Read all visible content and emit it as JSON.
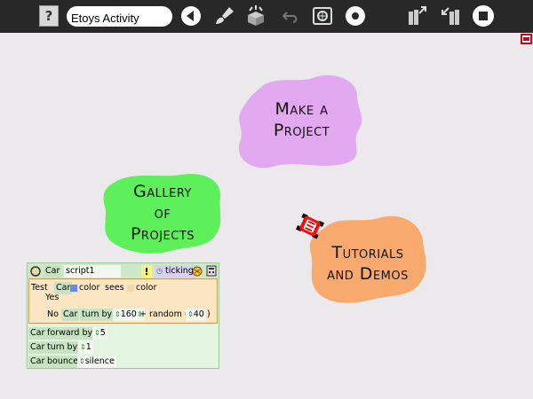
{
  "toolbar": {
    "project_title": "Etoys Activity",
    "help_label": "?",
    "icons": [
      "help-icon",
      "back-triangle-icon",
      "paint-brush-icon",
      "supplies-icon",
      "undo-icon",
      "find-project-icon",
      "record-icon",
      "keep-icon",
      "share-icon",
      "stop-icon"
    ]
  },
  "blobs": {
    "make_project": {
      "line1": "Make a",
      "line2": "Project",
      "color": "#e2a8f0"
    },
    "gallery": {
      "line1": "Gallery",
      "line2": "of",
      "line3": "Projects",
      "color": "#5ef05a"
    },
    "tutorials": {
      "line1": "Tutorials",
      "line2": "and Demos",
      "color": "#f8aa6e"
    }
  },
  "script": {
    "object": "Car",
    "name": "script1",
    "status": "ticking",
    "test_label": "Test",
    "test_object": "Car",
    "test_color_word": "color",
    "test_sees": "sees",
    "test_color2": "color",
    "yes_label": "Yes",
    "no_label": "No",
    "no_object": "Car",
    "no_command": "turn by",
    "no_value": "160",
    "plus_random": "+ random (",
    "random_value": "40",
    "close_paren": ")",
    "line1_object": "Car",
    "line1_command": "forward by",
    "line1_value": "5",
    "line2_object": "Car",
    "line2_command": "turn by",
    "line2_value": "1",
    "line3_object": "Car",
    "line3_command": "bounce",
    "line3_value": "silence"
  }
}
